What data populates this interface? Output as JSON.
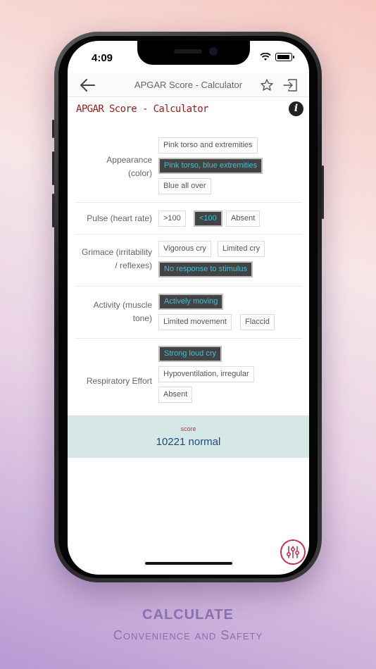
{
  "status_bar": {
    "time": "4:09"
  },
  "navbar": {
    "title": "APGAR Score - Calculator"
  },
  "page": {
    "title": "APGAR Score - Calculator"
  },
  "criteria": [
    {
      "label_lines": [
        "Appearance",
        "(color)"
      ],
      "options": [
        {
          "label": "Pink torso and extremities",
          "selected": false
        },
        {
          "label": "Pink torso, blue extremities",
          "selected": true
        },
        {
          "label": "Blue all over",
          "selected": false
        }
      ]
    },
    {
      "label_lines": [
        "Pulse (heart rate)"
      ],
      "options": [
        {
          "label": ">100",
          "selected": false
        },
        {
          "label": "<100",
          "selected": true
        },
        {
          "label": "Absent",
          "selected": false
        }
      ]
    },
    {
      "label_lines": [
        "Grimace (irritability",
        "/ reflexes)"
      ],
      "options": [
        {
          "label": "Vigorous cry",
          "selected": false
        },
        {
          "label": "Limited cry",
          "selected": false
        },
        {
          "label": "No response to stimulus",
          "selected": true
        }
      ]
    },
    {
      "label_lines": [
        "Activity (muscle",
        "tone)"
      ],
      "options": [
        {
          "label": "Actively moving",
          "selected": true
        },
        {
          "label": "Limited movement",
          "selected": false
        },
        {
          "label": "Flaccid",
          "selected": false
        }
      ]
    },
    {
      "label_lines": [
        "Respiratory Effort"
      ],
      "options": [
        {
          "label": "Strong loud cry",
          "selected": true
        },
        {
          "label": "Hypoventilation, irregular",
          "selected": false
        },
        {
          "label": "Absent",
          "selected": false
        }
      ]
    }
  ],
  "result": {
    "label": "score",
    "value": "10221 normal"
  },
  "caption": {
    "headline": "CALCULATE",
    "tagline": "Convenience and Safety"
  },
  "colors": {
    "title_red": "#9b1b1b",
    "selected_bg": "#434343",
    "selected_text": "#43c0d5",
    "score_bg": "#d6e8e6",
    "score_value": "#1d4a7a",
    "caption": "#8a6fb0"
  },
  "icons": {
    "back": "arrow-left-icon",
    "favorite": "star-outline-icon",
    "exit": "exit-icon",
    "info": "info-icon",
    "fab": "sliders-icon"
  }
}
